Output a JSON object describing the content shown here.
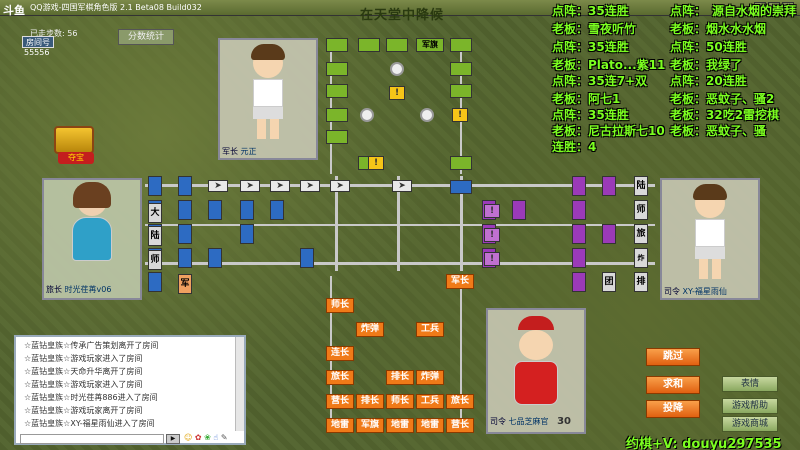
{
  "app": {
    "title": "QQ游戏-四国军棋角色版 2.1 Beta08 Build032",
    "logo_text": "斗鱼",
    "room_title": "在天堂中降候"
  },
  "toolbar": {
    "steps_label": "已走步数: 56",
    "roomnum_label": "房间号",
    "roomnum_value": "55556",
    "stats_button": "分数统计",
    "treasure_label": "夺宝"
  },
  "players": {
    "top": {
      "rank": "军长",
      "name": "元正"
    },
    "left": {
      "rank": "旅长",
      "name": "时光荏苒v06"
    },
    "right": {
      "rank": "司令",
      "name": "XY-福星雨仙"
    },
    "bottom": {
      "rank": "司令",
      "name": "七品芝麻官",
      "score": "30"
    }
  },
  "board": {
    "top_pieces": [
      "军旗"
    ],
    "left_pieces": [
      "大",
      "陆",
      "师",
      "军"
    ],
    "right_pieces": [
      "陆",
      "师",
      "旅",
      "炸",
      "排",
      "团"
    ],
    "bottom_pieces": {
      "r1": [
        "师长"
      ],
      "r2": [
        "炸弹",
        "工兵"
      ],
      "r3": [
        "连长"
      ],
      "r4": [
        "旅长",
        "排长",
        "炸弹"
      ],
      "r5": [
        "营长",
        "排长",
        "师长",
        "工兵",
        "旅长"
      ],
      "r6": [
        "地雷",
        "军旗",
        "地雷",
        "地雷",
        "营长"
      ]
    },
    "mid_left": "军长",
    "warn_glyph": "!",
    "arrow_glyph": "➤"
  },
  "overlay": {
    "left_col": [
      "点阵：35连胜",
      "老板：雪夜听竹",
      "点阵：35连胜",
      "老板：Plato...紫11",
      "点阵：35连7+双",
      "老板：阿七1",
      "点阵：35连胜",
      "老板：尼古拉斯七10",
      "连胜：4"
    ],
    "right_col": [
      "点阵：",
      "老板：烟水水水烟",
      "点阵：50连胜",
      "老板：我绿了",
      "点阵：20连胜",
      "老板：恶蚊子、骚2",
      "老板：32吃2雷挖棋",
      "老板：恶蚊子、骚"
    ],
    "right_col_top": "源自水烟的崇拜",
    "footer": "约棋+V: douyu297535"
  },
  "chat": {
    "lines": [
      "☆蓝钻皇族☆传承广告策划离开了房间",
      "☆蓝钻皇族☆游戏玩家进入了房间",
      "☆蓝钻皇族☆天命升华离开了房间",
      "☆蓝钻皇族☆游戏玩家进入了房间",
      "☆蓝钻皇族☆时光荏苒886进入了房间",
      "☆蓝钻皇族☆游戏玩家离开了房间",
      "☆蓝钻皇族☆XY-福星雨仙进入了房间"
    ],
    "send_label": "▶"
  },
  "actions": {
    "skip": "跳过",
    "peace": "求和",
    "surrender": "投降",
    "emotion": "表情",
    "help": "游戏帮助",
    "mall": "游戏商城"
  }
}
